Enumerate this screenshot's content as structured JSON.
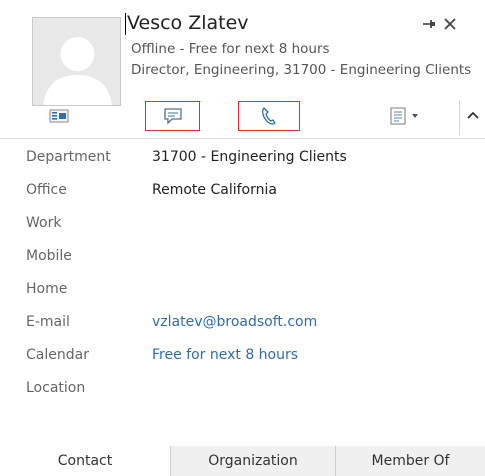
{
  "header": {
    "name": "Vesco Zlatev",
    "presence": "Offline - Free for next 8 hours",
    "title_line": "Director, Engineering, 31700 - Engineering Clients",
    "pin_icon": "pin-icon",
    "close_icon": "close-icon"
  },
  "toolbar": {
    "icons": [
      "contact-card-icon",
      "chat-bubble-icon",
      "phone-icon",
      "details-icon",
      "chevron-up-icon"
    ]
  },
  "fields": [
    {
      "label": "Department",
      "value": "31700 - Engineering Clients",
      "link": false
    },
    {
      "label": "Office",
      "value": "Remote California",
      "link": false
    },
    {
      "label": "Work",
      "value": "",
      "link": false
    },
    {
      "label": "Mobile",
      "value": "",
      "link": false
    },
    {
      "label": "Home",
      "value": "",
      "link": false
    },
    {
      "label": "E-mail",
      "value": "vzlatev@broadsoft.com",
      "link": true
    },
    {
      "label": "Calendar",
      "value": "Free for next 8 hours",
      "link": true
    },
    {
      "label": "Location",
      "value": "",
      "link": false
    }
  ],
  "tabs": [
    "Contact",
    "Organization",
    "Member Of"
  ],
  "colors": {
    "link": "#2f6bb5",
    "highlight_outline": "#e03030",
    "icon_blue": "#2c6fb1"
  }
}
